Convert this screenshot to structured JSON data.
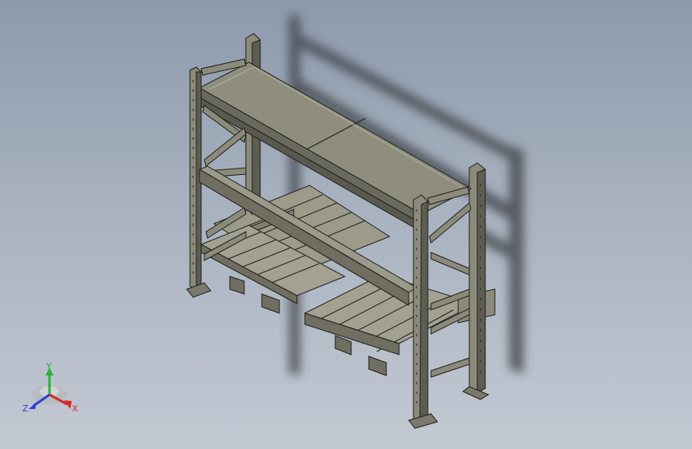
{
  "viewport": {
    "model": "pallet-rack-assembly",
    "colors": {
      "background_top": "#8d9aac",
      "background_bottom": "#c3c9d3",
      "steel": "#8c8b7b",
      "steel_dark": "#4a4a42",
      "edge": "#1f1f1c",
      "shadow": "#3c3f45"
    }
  },
  "triad": {
    "x_label": "X",
    "y_label": "Y",
    "z_label": "Z",
    "x_color": "#d42a2a",
    "y_color": "#28b03a",
    "z_color": "#2a3fd6"
  }
}
